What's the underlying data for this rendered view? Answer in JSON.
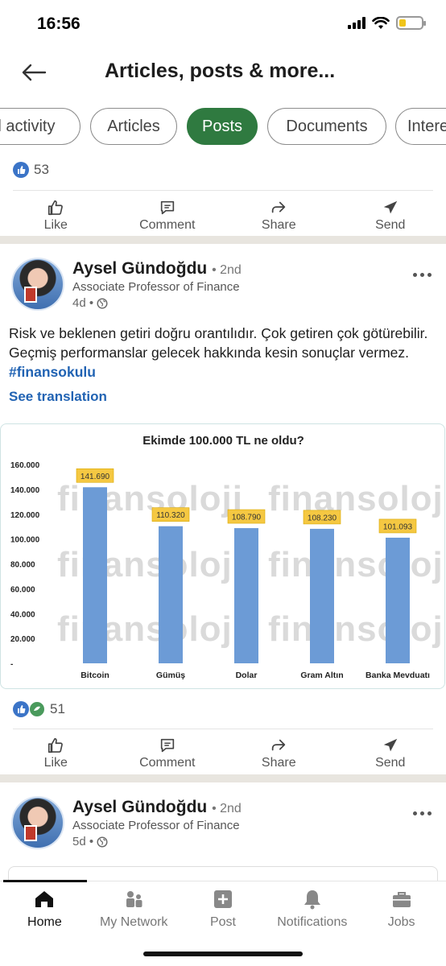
{
  "status_bar": {
    "time": "16:56"
  },
  "header": {
    "title": "Articles, posts & more..."
  },
  "filters": [
    {
      "label": "All activity",
      "active": false
    },
    {
      "label": "Articles",
      "active": false
    },
    {
      "label": "Posts",
      "active": true
    },
    {
      "label": "Documents",
      "active": false
    },
    {
      "label": "Interests",
      "active": false
    }
  ],
  "post0": {
    "reaction_count": "53"
  },
  "actions": {
    "like": "Like",
    "comment": "Comment",
    "share": "Share",
    "send": "Send"
  },
  "post1": {
    "author": "Aysel Gündoğdu",
    "degree": "• 2nd",
    "headline": "Associate Professor of Finance",
    "age": "4d •",
    "text": "Risk ve beklenen getiri doğru orantılıdır. Çok getiren çok götürebilir. Geçmiş performanslar gelecek hakkında kesin sonuçlar vermez.",
    "hashtag": "#finansokulu",
    "see_translation": "See translation",
    "reaction_count": "51"
  },
  "post2": {
    "author": "Aysel Gündoğdu",
    "degree": "• 2nd",
    "headline": "Associate Professor of Finance",
    "age": "5d •"
  },
  "chart_data": {
    "type": "bar",
    "title": "Ekimde 100.000 TL ne oldu?",
    "categories": [
      "Bitcoin",
      "Gümüş",
      "Dolar",
      "Gram Altın",
      "Banka Mevduatı"
    ],
    "values": [
      141690,
      110320,
      108790,
      108230,
      101093
    ],
    "value_labels": [
      "141.690",
      "110.320",
      "108.790",
      "108.230",
      "101.093"
    ],
    "y_ticks": [
      "160.000",
      "140.000",
      "120.000",
      "100.000",
      "80.000",
      "60.000",
      "40.000",
      "20.000",
      "-"
    ],
    "ylim": [
      0,
      160000
    ],
    "bar_color": "#6c9bd6",
    "label_color": "#f5c842",
    "watermark": "finansoloji",
    "grid": false,
    "xlabel": "",
    "ylabel": ""
  },
  "tabs": [
    {
      "label": "Home",
      "icon": "home-icon",
      "active": true
    },
    {
      "label": "My Network",
      "icon": "network-icon",
      "active": false
    },
    {
      "label": "Post",
      "icon": "post-icon",
      "active": false
    },
    {
      "label": "Notifications",
      "icon": "bell-icon",
      "active": false
    },
    {
      "label": "Jobs",
      "icon": "briefcase-icon",
      "active": false
    }
  ],
  "colors": {
    "accent_green": "#2f7a40",
    "link_blue": "#2163b3"
  }
}
